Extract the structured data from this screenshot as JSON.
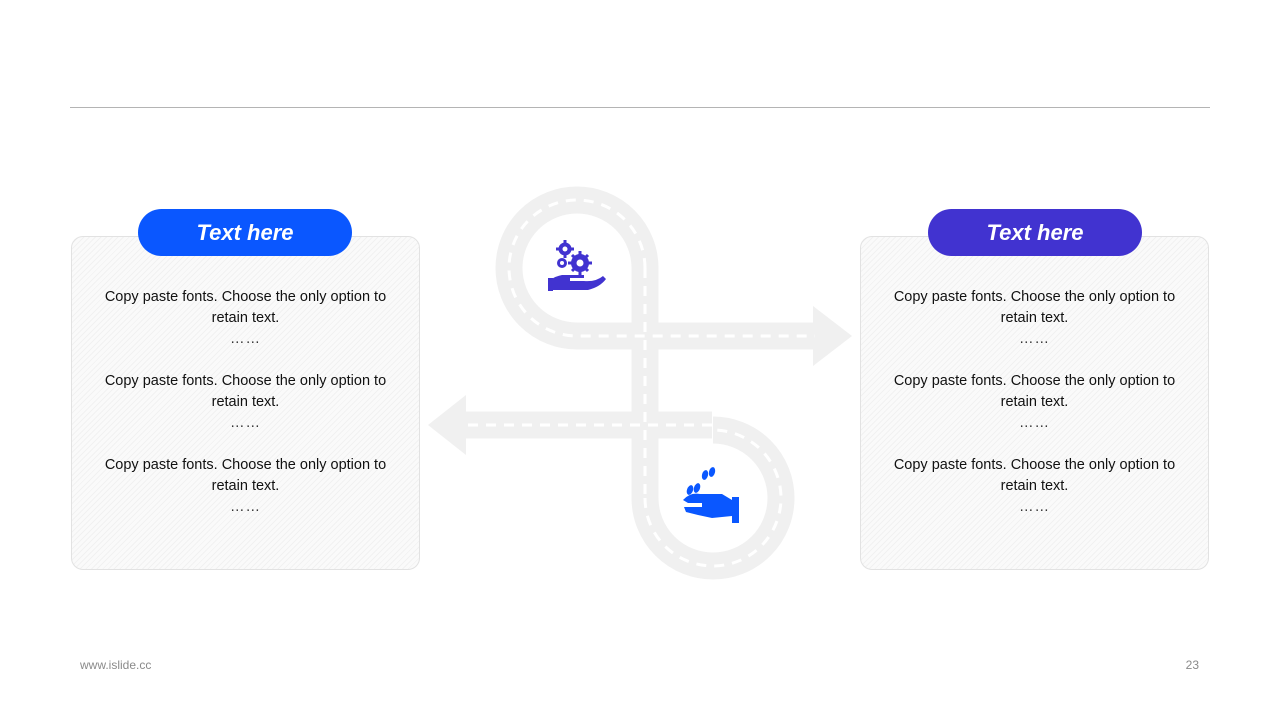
{
  "left_panel": {
    "title": "Text here",
    "items": [
      {
        "text": "Copy paste fonts. Choose the only option to retain text.",
        "dots": "……"
      },
      {
        "text": "Copy paste fonts. Choose the only option to retain text.",
        "dots": "……"
      },
      {
        "text": "Copy paste fonts. Choose the only option to retain text.",
        "dots": "……"
      }
    ]
  },
  "right_panel": {
    "title": "Text here",
    "items": [
      {
        "text": "Copy paste fonts. Choose the only option to retain text.",
        "dots": "……"
      },
      {
        "text": "Copy paste fonts. Choose the only option to retain text.",
        "dots": "……"
      },
      {
        "text": "Copy paste fonts. Choose the only option to retain text.",
        "dots": "……"
      }
    ]
  },
  "icons": {
    "top": "gears-hand-icon",
    "bottom": "coins-hand-icon"
  },
  "colors": {
    "blue": "#0a57ff",
    "purple": "#4133d0",
    "road": "#f0f0f0"
  },
  "footer": {
    "website": "www.islide.cc",
    "page_number": "23"
  }
}
